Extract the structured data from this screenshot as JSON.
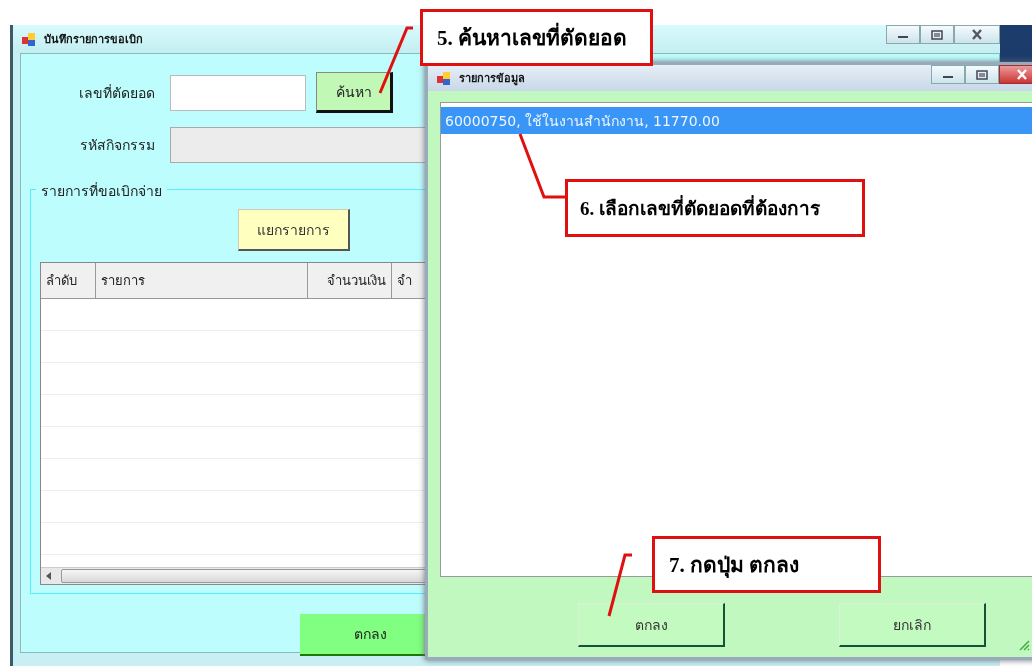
{
  "main_window": {
    "title": "บันทึกรายการขอเบิก",
    "fields": [
      {
        "label": "เลขที่ตัดยอด",
        "disabled": false
      },
      {
        "label": "รหัสกิจกรรม",
        "disabled": true
      }
    ],
    "search_button": "ค้นหา",
    "group": {
      "title": "รายการที่ขอเบิกจ่าย",
      "split_button": "แยกรายการ",
      "table": {
        "columns": [
          "ลำดับ",
          "รายการ",
          "จำนวนเงิน",
          "จำ"
        ]
      }
    },
    "ok_button": "ตกลง"
  },
  "dialog": {
    "title": "รายการข้อมูล",
    "items": [
      {
        "text": "60000750, ใช้ในงานสำนักงาน, 11770.00",
        "selected": true
      }
    ],
    "buttons": [
      "ตกลง",
      "ยกเลิก"
    ]
  },
  "callouts": [
    {
      "text": "5. ค้นหาเลขที่ตัดยอด"
    },
    {
      "text": "6. เลือกเลขที่ตัดยอดที่ต้องการ"
    },
    {
      "text": "7. กดปุ่ม ตกลง"
    }
  ]
}
